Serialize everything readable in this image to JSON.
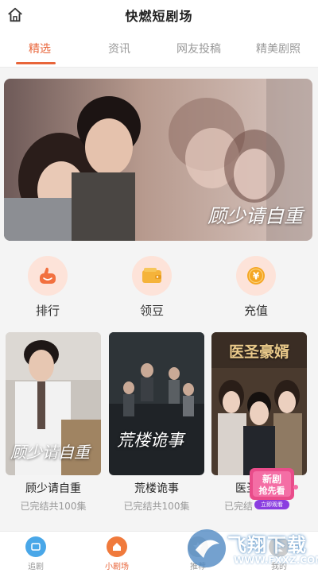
{
  "header": {
    "title": "快燃短剧场",
    "home_icon": "home-icon"
  },
  "tabs": [
    {
      "label": "精选",
      "active": true
    },
    {
      "label": "资讯",
      "active": false
    },
    {
      "label": "网友投稿",
      "active": false
    },
    {
      "label": "精美剧照",
      "active": false
    }
  ],
  "banner": {
    "caption": "顾少请自重"
  },
  "quick_actions": [
    {
      "label": "排行",
      "icon": "thumbs-up-icon",
      "color": "#f2703f"
    },
    {
      "label": "领豆",
      "icon": "wallet-icon",
      "color": "#f5b33a"
    },
    {
      "label": "充值",
      "icon": "yen-coin-icon",
      "color": "#f5a623"
    }
  ],
  "dramas": [
    {
      "title": "顾少请自重",
      "poster_text": "顾少请自重",
      "status": "已完结共100集"
    },
    {
      "title": "荒楼诡事",
      "poster_text": "荒楼诡事",
      "status": "已完结共100集"
    },
    {
      "title": "医圣",
      "poster_text": "医圣豪婿",
      "status": "已完结"
    }
  ],
  "new_badge": {
    "line1": "新剧",
    "line2": "抢先看",
    "line3": "立即观看"
  },
  "bottom_nav": [
    {
      "label": "追剧",
      "icon": "tv-icon",
      "active": false
    },
    {
      "label": "小剧场",
      "icon": "home-icon",
      "active": true
    },
    {
      "label": "推荐",
      "icon": "star-icon",
      "active": false
    },
    {
      "label": "我的",
      "icon": "user-icon",
      "active": false
    }
  ],
  "watermark": {
    "text": "飞翔下载",
    "url": "WWW.FXXZ.COM"
  },
  "colors": {
    "accent": "#e8653a",
    "tab_inactive": "#999999",
    "icon_bg": "#fde3d9"
  }
}
